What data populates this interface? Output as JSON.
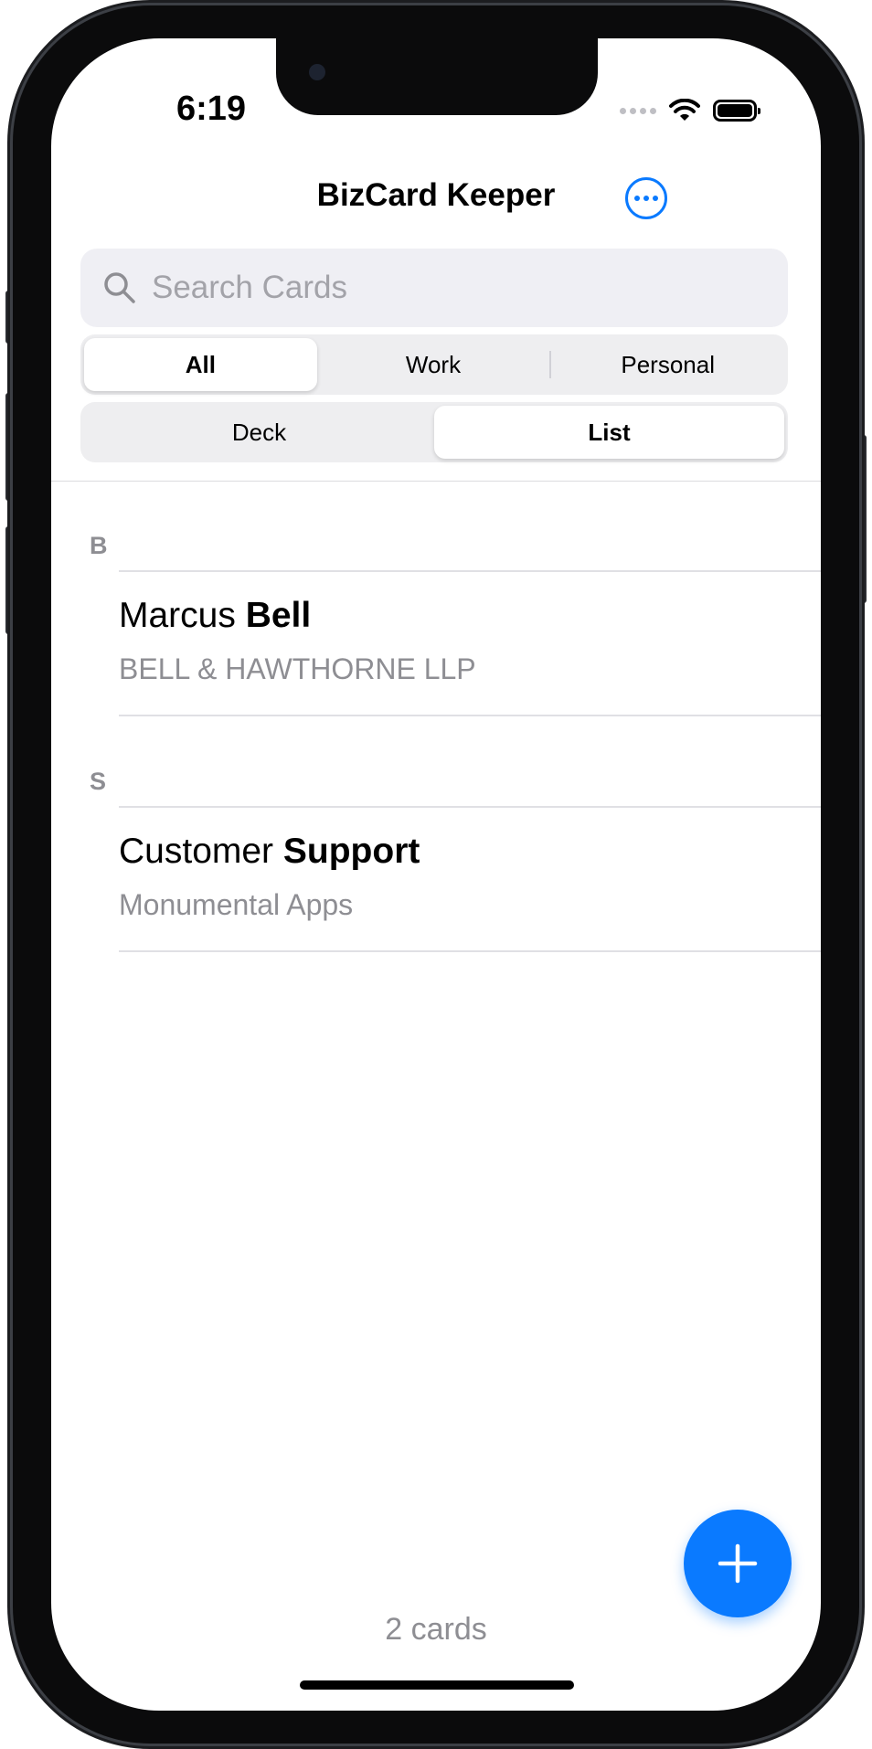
{
  "status_bar": {
    "time": "6:19"
  },
  "nav": {
    "title": "BizCard Keeper",
    "more_icon": "ellipsis-circle-icon"
  },
  "search": {
    "placeholder": "Search Cards",
    "value": ""
  },
  "filter_segment": {
    "options": [
      "All",
      "Work",
      "Personal"
    ],
    "selected": "All"
  },
  "view_segment": {
    "options": [
      "Deck",
      "List"
    ],
    "selected": "List"
  },
  "sections": [
    {
      "letter": "B",
      "cards": [
        {
          "first": "Marcus",
          "last": "Bell",
          "company": "BELL & HAWTHORNE LLP"
        }
      ]
    },
    {
      "letter": "S",
      "cards": [
        {
          "first": "Customer",
          "last": "Support",
          "company": "Monumental Apps"
        }
      ]
    }
  ],
  "footer": {
    "count_label": "2 cards"
  },
  "fab": {
    "icon": "plus-icon"
  },
  "colors": {
    "accent": "#0A7AFF",
    "secondary_text": "#8E8E93",
    "search_bg": "#EFEFF4"
  }
}
